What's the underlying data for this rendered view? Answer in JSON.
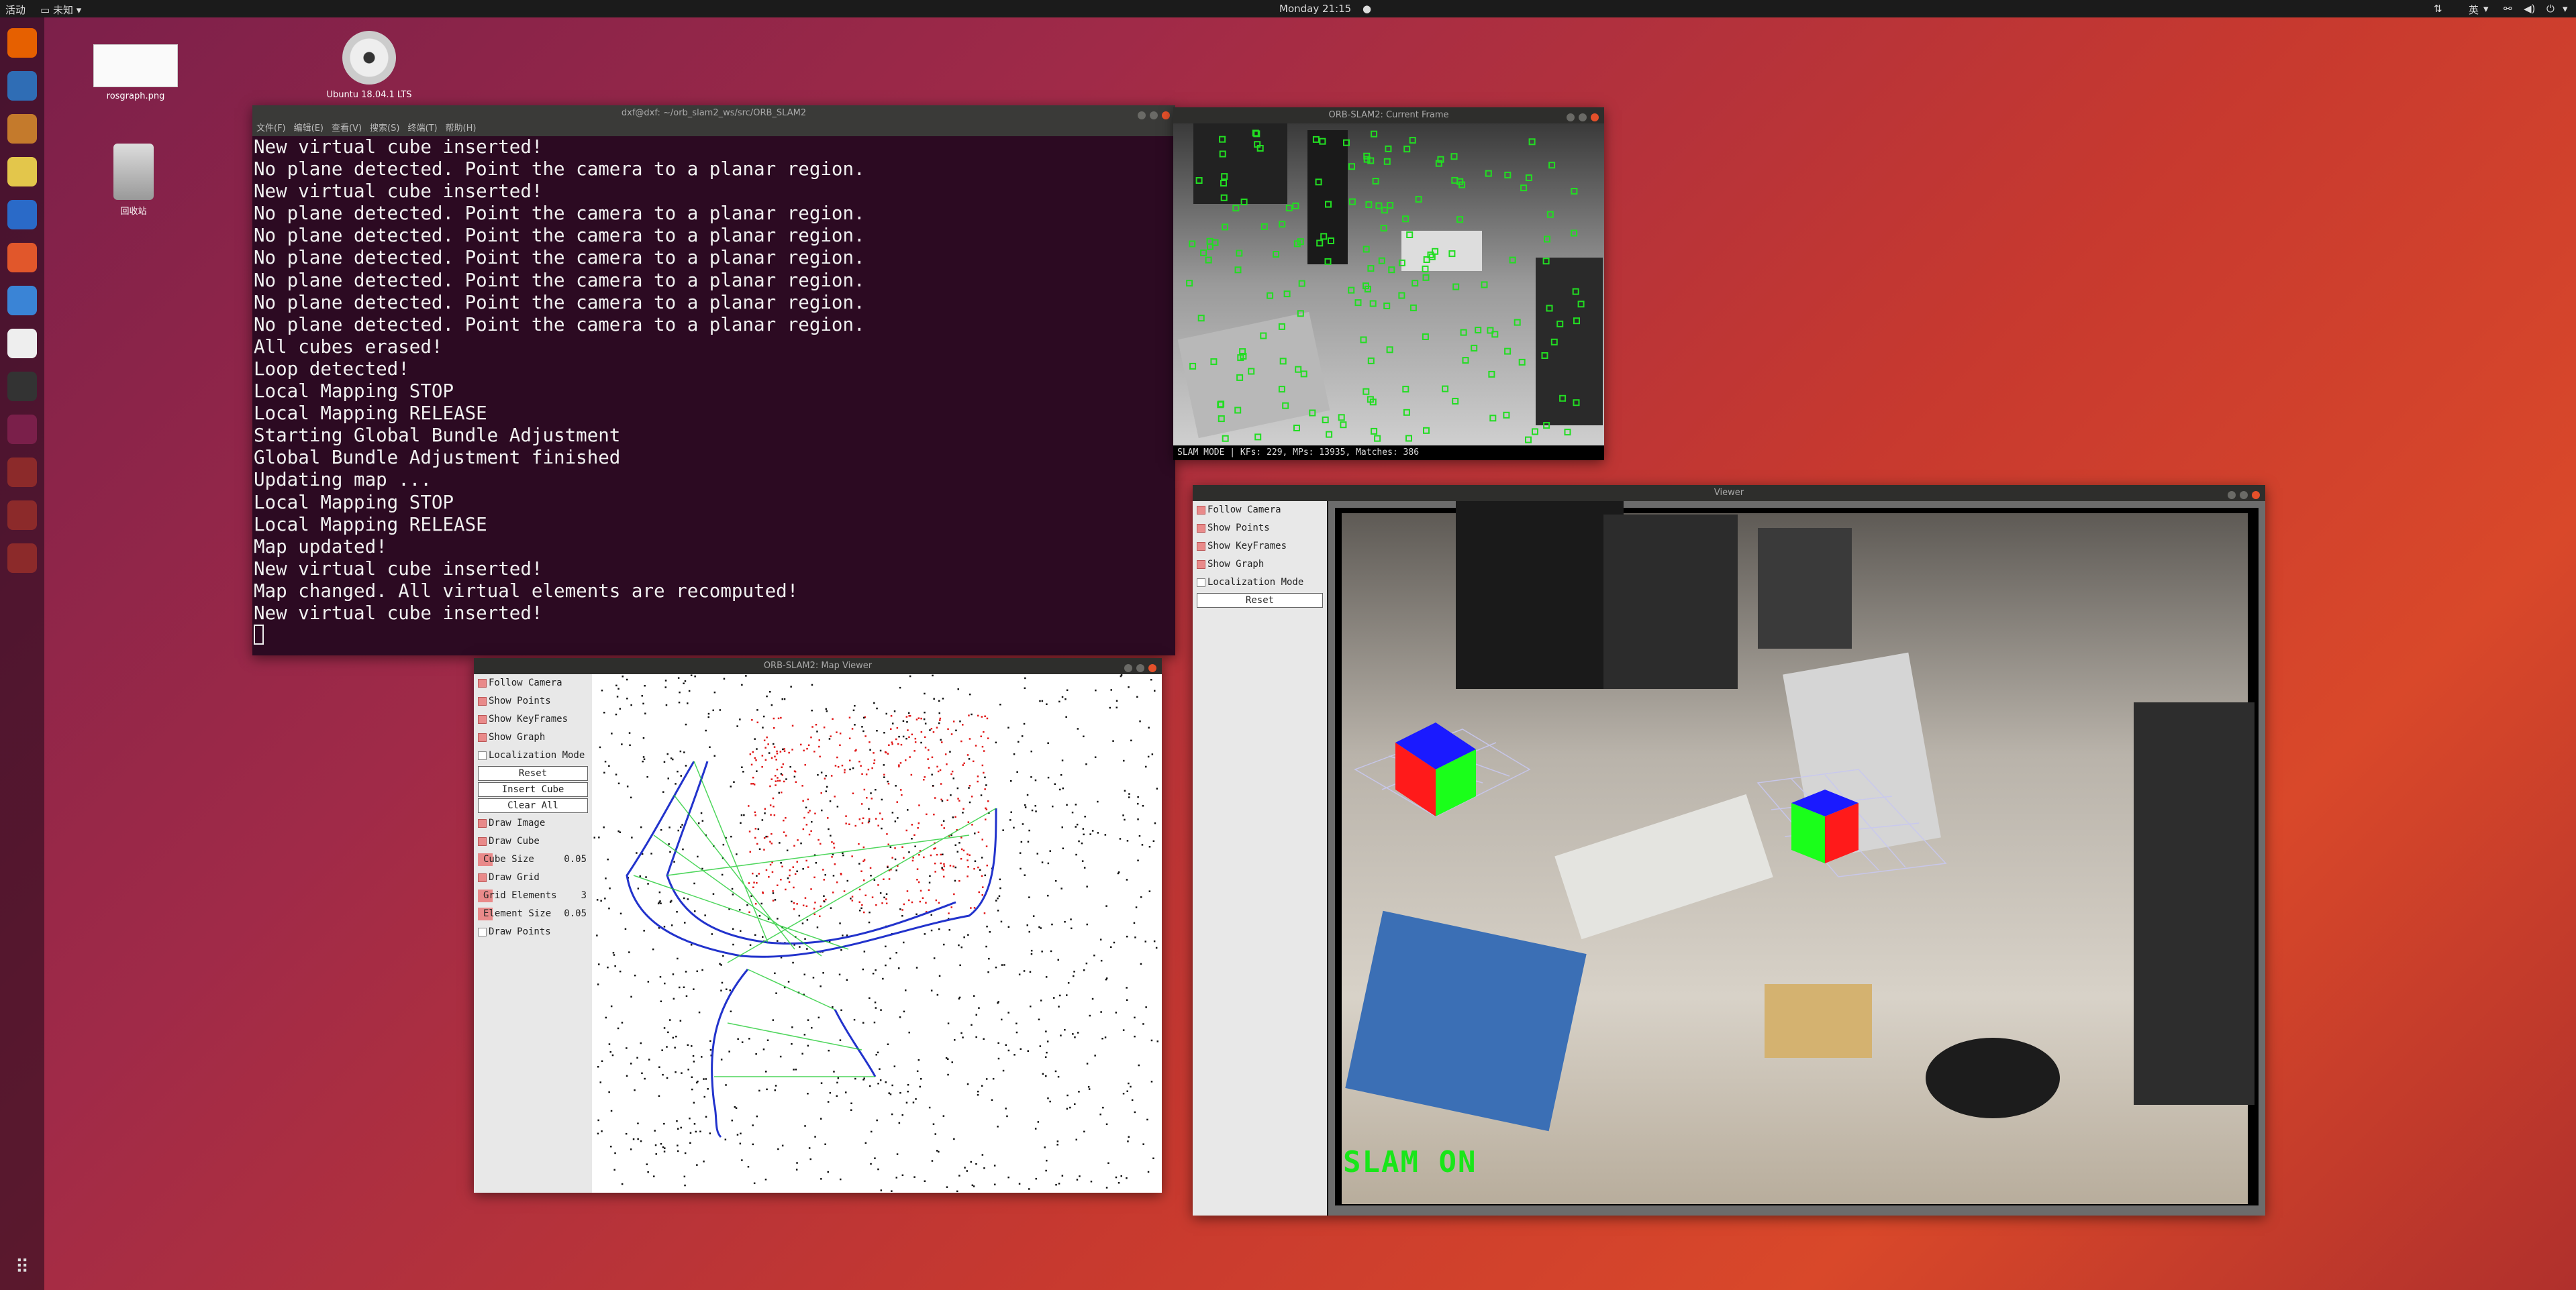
{
  "topbar": {
    "activities": "活动",
    "app_menu": "未知",
    "clock": "Monday 21:15",
    "input_method": "英"
  },
  "desktop_icons": [
    {
      "label": "rosgraph.png",
      "icon": "image-file-icon"
    },
    {
      "label": "Ubuntu 18.04.1 LTS",
      "icon": "dvd-icon"
    },
    {
      "label": "回收站",
      "icon": "trash-icon"
    }
  ],
  "dock": [
    {
      "name": "firefox",
      "icon": "firefox-icon",
      "color": "#e66000"
    },
    {
      "name": "thunderbird",
      "icon": "thunderbird-icon",
      "color": "#2f6db5"
    },
    {
      "name": "files",
      "icon": "files-icon",
      "color": "#c47a2c"
    },
    {
      "name": "rhythmbox",
      "icon": "rhythmbox-icon",
      "color": "#e3c64b"
    },
    {
      "name": "writer",
      "icon": "writer-icon",
      "color": "#2a6ac8"
    },
    {
      "name": "software",
      "icon": "software-icon",
      "color": "#e1572b"
    },
    {
      "name": "help",
      "icon": "help-icon",
      "color": "#3a84d6"
    },
    {
      "name": "amazon",
      "icon": "amazon-icon",
      "color": "#eeeeee"
    },
    {
      "name": "terminal",
      "icon": "terminal-icon",
      "color": "#333333"
    },
    {
      "name": "clion",
      "icon": "clion-icon",
      "color": "#7a1f4a"
    },
    {
      "name": "window1",
      "icon": "window-icon",
      "color": "#8c2a2a"
    },
    {
      "name": "window2",
      "icon": "window-icon",
      "color": "#8c2a2a"
    },
    {
      "name": "window3",
      "icon": "window-icon",
      "color": "#8c2a2a"
    }
  ],
  "terminal": {
    "title": "dxf@dxf: ~/orb_slam2_ws/src/ORB_SLAM2",
    "menu": [
      "文件(F)",
      "编辑(E)",
      "查看(V)",
      "搜索(S)",
      "终端(T)",
      "帮助(H)"
    ],
    "lines": [
      "New virtual cube inserted!",
      "No plane detected. Point the camera to a planar region.",
      "New virtual cube inserted!",
      "No plane detected. Point the camera to a planar region.",
      "No plane detected. Point the camera to a planar region.",
      "No plane detected. Point the camera to a planar region.",
      "No plane detected. Point the camera to a planar region.",
      "No plane detected. Point the camera to a planar region.",
      "No plane detected. Point the camera to a planar region.",
      "All cubes erased!",
      "Loop detected!",
      "Local Mapping STOP",
      "Local Mapping RELEASE",
      "Starting Global Bundle Adjustment",
      "Global Bundle Adjustment finished",
      "Updating map ...",
      "Local Mapping STOP",
      "Local Mapping RELEASE",
      "Map updated!",
      "New virtual cube inserted!",
      "Map changed. All virtual elements are recomputed!",
      "New virtual cube inserted!"
    ]
  },
  "current_frame": {
    "title": "ORB-SLAM2: Current Frame",
    "status": "SLAM MODE |  KFs: 229, MPs: 13935, Matches: 386"
  },
  "map_viewer": {
    "title": "ORB-SLAM2: Map Viewer",
    "follow_camera": "Follow Camera",
    "show_points": "Show Points",
    "show_keyframes": "Show KeyFrames",
    "show_graph": "Show Graph",
    "localization_mode": "Localization Mode",
    "reset": "Reset",
    "insert_cube": "Insert Cube",
    "clear_all": "Clear All",
    "draw_image": "Draw Image",
    "draw_cube": "Draw Cube",
    "cube_size_label": "Cube Size",
    "cube_size_value": "0.05",
    "draw_grid": "Draw Grid",
    "grid_elements_label": "Grid Elements",
    "grid_elements_value": "3",
    "element_size_label": "Element Size",
    "element_size_value": "0.05",
    "draw_points": "Draw Points"
  },
  "viewer": {
    "title": "Viewer",
    "follow_camera": "Follow Camera",
    "show_points": "Show Points",
    "show_keyframes": "Show KeyFrames",
    "show_graph": "Show Graph",
    "localization_mode": "Localization Mode",
    "reset": "Reset",
    "overlay": "SLAM ON"
  },
  "colors": {
    "terminal_bg": "#2c0a22",
    "checkbox_on": "#e98a8a",
    "slam_overlay": "#19e619",
    "feature_green": "#22dd22"
  }
}
